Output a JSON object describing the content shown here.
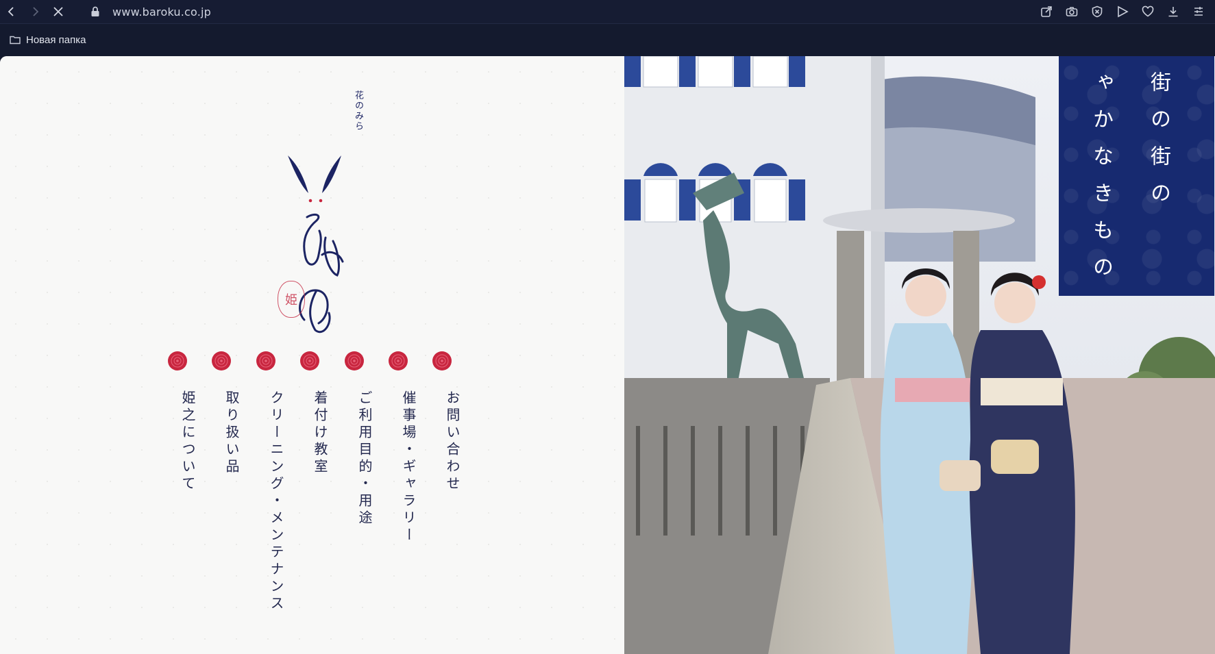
{
  "browser": {
    "url": "www.baroku.co.jp",
    "bookmark_folder": "Новая папка"
  },
  "logo": {
    "small_text": "花のみら",
    "main_text": [
      "ひ",
      "め",
      "の"
    ],
    "seal_text": "姫"
  },
  "menu": {
    "items": [
      {
        "label": "お問い合わせ"
      },
      {
        "label": "催事場・ギャラリー"
      },
      {
        "label": "ご利用目的・用途"
      },
      {
        "label": "着付け教室"
      },
      {
        "label": "クリーニング・メンテナンス"
      },
      {
        "label": "取り扱い品"
      },
      {
        "label": "姫之について"
      }
    ]
  },
  "banner": {
    "col1": "ゃかなきもの",
    "col2": "街の街の"
  },
  "colors": {
    "chrome": "#161c33",
    "accent_red": "#c8263f",
    "navy": "#1c2463",
    "banner": "#172a70"
  },
  "icons": [
    "back-icon",
    "forward-icon",
    "stop-icon",
    "lock-icon",
    "share-icon",
    "camera-icon",
    "shield-icon",
    "send-icon",
    "heart-icon",
    "download-icon",
    "menu-icon",
    "folder-icon"
  ]
}
